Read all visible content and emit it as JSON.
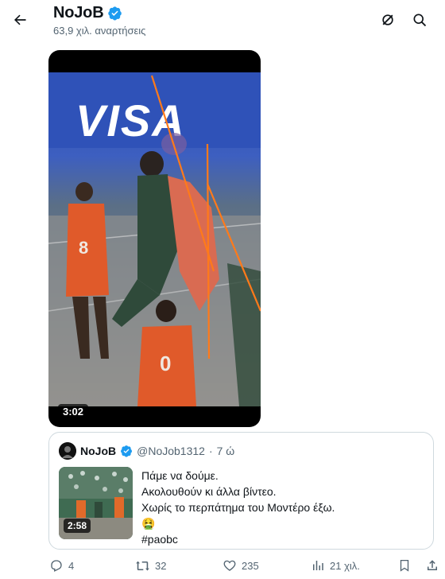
{
  "header": {
    "back_icon": "arrow-left-icon",
    "title": "NoJoB",
    "subtitle": "63,9 χιλ. αναρτήσεις",
    "verified_color": "#1d9bf0",
    "right_icons": [
      "grok-icon",
      "search-icon"
    ]
  },
  "video": {
    "duration": "3:02",
    "overlay_text": "VISA",
    "jersey_numbers": [
      "8",
      "0"
    ],
    "annotation_color": "#ff7a1a"
  },
  "quote": {
    "name": "NoJoB",
    "handle": "@NoJob1312",
    "dot": "·",
    "time": "7 ώ",
    "thumb_duration": "2:58",
    "lines": [
      "Πάμε να δούμε.",
      "Ακολουθούν κι άλλα βίντεο.",
      "Χωρίς το περπάτημα του Μοντέρο έξω.",
      "🤮",
      "#paobc"
    ]
  },
  "actions": {
    "replies": "4",
    "reposts": "32",
    "likes": "235",
    "views": "21 χιλ.",
    "icons": [
      "reply-icon",
      "repost-icon",
      "like-icon",
      "views-icon",
      "bookmark-icon",
      "share-icon"
    ]
  }
}
